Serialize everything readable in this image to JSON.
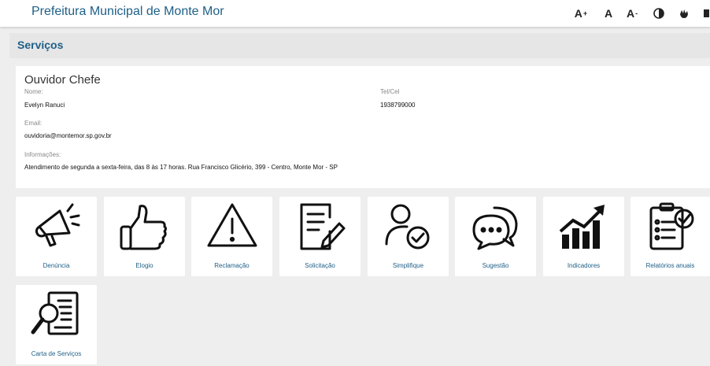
{
  "header": {
    "title": "Prefeitura Municipal de Monte Mor",
    "a11y": {
      "increase": "A",
      "increase_sup": "+",
      "normal": "A",
      "decrease": "A",
      "decrease_sup": "-"
    }
  },
  "section": {
    "title": "Serviços"
  },
  "ouvidor": {
    "heading": "Ouvidor Chefe",
    "name_label": "Nome:",
    "name": "Evelyn Ranuci",
    "phone_label": "Tel/Cel",
    "phone": "1938799000",
    "email_label": "Email:",
    "email": "ouvidoria@montemor.sp.gov.br",
    "info_label": "Informações:",
    "info": "Atendimento de segunda a sexta-feira, das 8 às 17 horas. Rua Francisco Glicério, 399 - Centro, Monte Mor - SP"
  },
  "services": [
    {
      "label": "Denúncia",
      "icon": "megaphone-icon"
    },
    {
      "label": "Elogio",
      "icon": "thumbs-up-icon"
    },
    {
      "label": "Reclamação",
      "icon": "warning-icon"
    },
    {
      "label": "Solicitação",
      "icon": "document-pen-icon"
    },
    {
      "label": "Simplifique",
      "icon": "user-check-icon"
    },
    {
      "label": "Sugestão",
      "icon": "chat-bubbles-icon"
    },
    {
      "label": "Indicadores",
      "icon": "growth-chart-icon"
    },
    {
      "label": "Relatórios anuais",
      "icon": "clipboard-checklist-icon"
    },
    {
      "label": "Carta de Serviços",
      "icon": "document-search-icon"
    }
  ],
  "colors": {
    "brand": "#1d5f87",
    "background": "#eeeeee"
  }
}
